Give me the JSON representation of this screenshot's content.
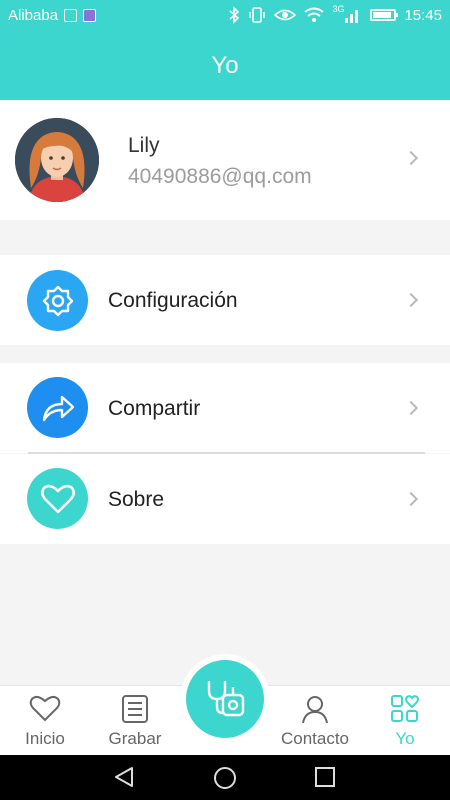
{
  "status_bar": {
    "carrier": "Alibaba",
    "network": "3G",
    "time": "15:45",
    "icons": [
      "image-icon",
      "mail-icon",
      "bluetooth-icon",
      "vibrate-icon",
      "eye-icon",
      "wifi-icon",
      "signal-icon",
      "battery-icon"
    ]
  },
  "header": {
    "title": "Yo"
  },
  "profile": {
    "name": "Lily",
    "email": "40490886@qq.com"
  },
  "menu": {
    "settings": {
      "label": "Configuración",
      "icon": "gear-icon",
      "color": "#2aa6f2"
    },
    "share": {
      "label": "Compartir",
      "icon": "share-arrow-icon",
      "color": "#1e8ef0"
    },
    "about": {
      "label": "Sobre",
      "icon": "heart-icon",
      "color": "#3dd6cf"
    }
  },
  "bottom_nav": {
    "items": [
      {
        "label": "Inicio",
        "icon": "heart-outline-icon"
      },
      {
        "label": "Grabar",
        "icon": "list-icon"
      },
      {
        "label": "Contacto",
        "icon": "person-icon"
      },
      {
        "label": "Yo",
        "icon": "grid-heart-icon",
        "active": true
      }
    ],
    "center_button": {
      "icon": "stethoscope-icon"
    }
  },
  "system_nav": {
    "icons": [
      "back-icon",
      "home-icon",
      "recents-icon"
    ]
  },
  "colors": {
    "accent": "#3dd6cf",
    "background": "#f4f4f4",
    "text": "#222222",
    "muted": "#9c9c9c"
  }
}
